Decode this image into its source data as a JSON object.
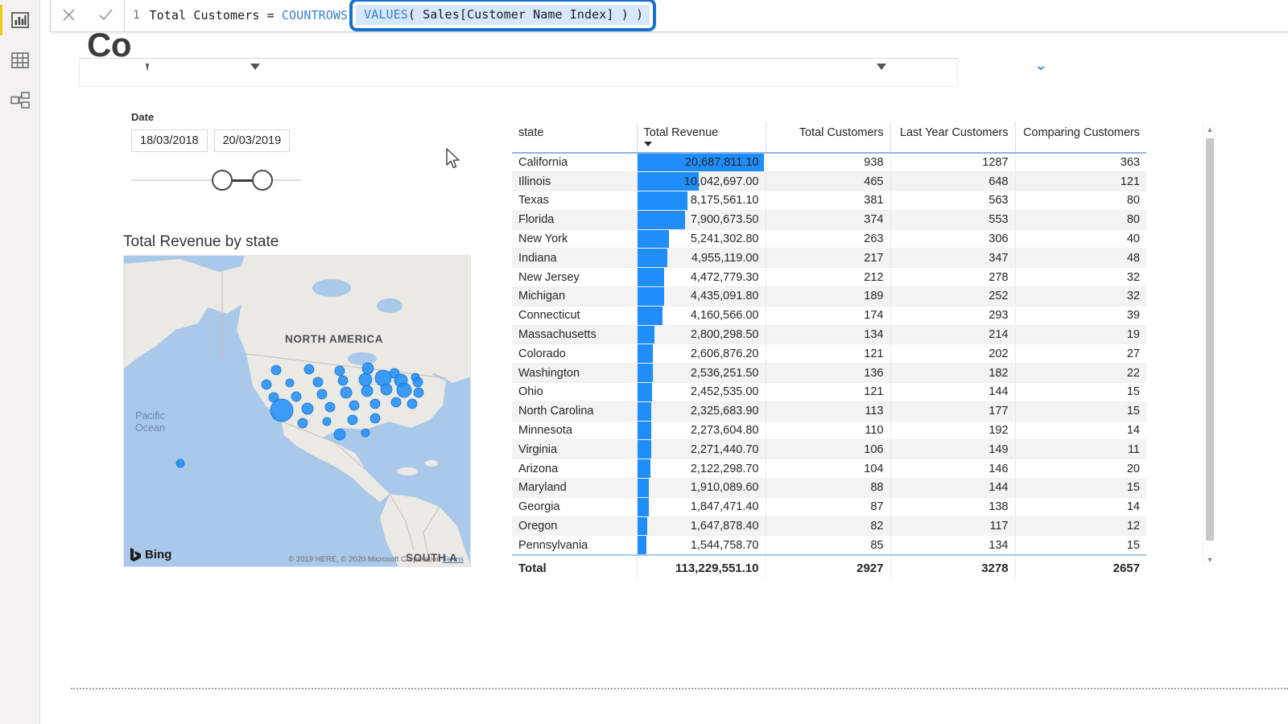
{
  "app": {
    "page_title": "Co",
    "rail_items": [
      {
        "name": "report-view",
        "icon": "bar-chart-icon",
        "active": true
      },
      {
        "name": "data-view",
        "icon": "table-icon",
        "active": false
      },
      {
        "name": "model-view",
        "icon": "relationships-icon",
        "active": false
      }
    ]
  },
  "formula_bar": {
    "cancel_label": "✕",
    "commit_label": "✓",
    "line_number": "1",
    "measure_name": "Total Customers",
    "equals": "=",
    "function_1": "COUNTROWS",
    "selected_expression": "VALUES( Sales[Customer Name Index] ) )",
    "selected_keyword": "VALUES",
    "selected_rest": "( Sales[Customer Name Index] ) )",
    "selection_outline_color": "#1870d2",
    "selection_bg_color": "#d6e8fb"
  },
  "slicer": {
    "label": "Date",
    "start_date": "18/03/2018",
    "end_date": "20/03/2019"
  },
  "map": {
    "title": "Total Revenue by state",
    "region_label_north": "NORTH AMERICA",
    "region_label_south": "SOUTH A",
    "ocean_label": "Pacific\nOcean",
    "ocean_label_line1": "Pacific",
    "ocean_label_line2": "Ocean",
    "brand": "Bing",
    "attribution": "© 2019 HERE, © 2020 Microsoft Corporation",
    "terms_link": "Terms",
    "bubble_color": "#1f8efa"
  },
  "table": {
    "columns": [
      "state",
      "Total Revenue",
      "Total Customers",
      "Last Year Customers",
      "Comparing Customers"
    ],
    "sort_column": "Total Revenue",
    "sort_direction": "descending",
    "data_bar_color": "#1f8efa",
    "rows": [
      {
        "state": "California",
        "total_revenue": "20,687,811.10",
        "revenue_value": 20687811.1,
        "total_customers": "938",
        "last_year_customers": "1287",
        "comparing_customers": "363"
      },
      {
        "state": "Illinois",
        "total_revenue": "10,042,697.00",
        "revenue_value": 10042697.0,
        "total_customers": "465",
        "last_year_customers": "648",
        "comparing_customers": "121"
      },
      {
        "state": "Texas",
        "total_revenue": "8,175,561.10",
        "revenue_value": 8175561.1,
        "total_customers": "381",
        "last_year_customers": "563",
        "comparing_customers": "80"
      },
      {
        "state": "Florida",
        "total_revenue": "7,900,673.50",
        "revenue_value": 7900673.5,
        "total_customers": "374",
        "last_year_customers": "553",
        "comparing_customers": "80"
      },
      {
        "state": "New York",
        "total_revenue": "5,241,302.80",
        "revenue_value": 5241302.8,
        "total_customers": "263",
        "last_year_customers": "306",
        "comparing_customers": "40"
      },
      {
        "state": "Indiana",
        "total_revenue": "4,955,119.00",
        "revenue_value": 4955119.0,
        "total_customers": "217",
        "last_year_customers": "347",
        "comparing_customers": "48"
      },
      {
        "state": "New Jersey",
        "total_revenue": "4,472,779.30",
        "revenue_value": 4472779.3,
        "total_customers": "212",
        "last_year_customers": "278",
        "comparing_customers": "32"
      },
      {
        "state": "Michigan",
        "total_revenue": "4,435,091.80",
        "revenue_value": 4435091.8,
        "total_customers": "189",
        "last_year_customers": "252",
        "comparing_customers": "32"
      },
      {
        "state": "Connecticut",
        "total_revenue": "4,160,566.00",
        "revenue_value": 4160566.0,
        "total_customers": "174",
        "last_year_customers": "293",
        "comparing_customers": "39"
      },
      {
        "state": "Massachusetts",
        "total_revenue": "2,800,298.50",
        "revenue_value": 2800298.5,
        "total_customers": "134",
        "last_year_customers": "214",
        "comparing_customers": "19"
      },
      {
        "state": "Colorado",
        "total_revenue": "2,606,876.20",
        "revenue_value": 2606876.2,
        "total_customers": "121",
        "last_year_customers": "202",
        "comparing_customers": "27"
      },
      {
        "state": "Washington",
        "total_revenue": "2,536,251.50",
        "revenue_value": 2536251.5,
        "total_customers": "136",
        "last_year_customers": "182",
        "comparing_customers": "22"
      },
      {
        "state": "Ohio",
        "total_revenue": "2,452,535.00",
        "revenue_value": 2452535.0,
        "total_customers": "121",
        "last_year_customers": "144",
        "comparing_customers": "15"
      },
      {
        "state": "North Carolina",
        "total_revenue": "2,325,683.90",
        "revenue_value": 2325683.9,
        "total_customers": "113",
        "last_year_customers": "177",
        "comparing_customers": "15"
      },
      {
        "state": "Minnesota",
        "total_revenue": "2,273,604.80",
        "revenue_value": 2273604.8,
        "total_customers": "110",
        "last_year_customers": "192",
        "comparing_customers": "14"
      },
      {
        "state": "Virginia",
        "total_revenue": "2,271,440.70",
        "revenue_value": 2271440.7,
        "total_customers": "106",
        "last_year_customers": "149",
        "comparing_customers": "11"
      },
      {
        "state": "Arizona",
        "total_revenue": "2,122,298.70",
        "revenue_value": 2122298.7,
        "total_customers": "104",
        "last_year_customers": "146",
        "comparing_customers": "20"
      },
      {
        "state": "Maryland",
        "total_revenue": "1,910,089.60",
        "revenue_value": 1910089.6,
        "total_customers": "88",
        "last_year_customers": "144",
        "comparing_customers": "15"
      },
      {
        "state": "Georgia",
        "total_revenue": "1,847,471.40",
        "revenue_value": 1847471.4,
        "total_customers": "87",
        "last_year_customers": "138",
        "comparing_customers": "14"
      },
      {
        "state": "Oregon",
        "total_revenue": "1,647,878.40",
        "revenue_value": 1647878.4,
        "total_customers": "82",
        "last_year_customers": "117",
        "comparing_customers": "12"
      },
      {
        "state": "Pennsylvania",
        "total_revenue": "1,544,758.70",
        "revenue_value": 1544758.7,
        "total_customers": "85",
        "last_year_customers": "134",
        "comparing_customers": "15"
      }
    ],
    "total_row": {
      "state": "Total",
      "total_revenue": "113,229,551.10",
      "total_customers": "2927",
      "last_year_customers": "3278",
      "comparing_customers": "2657"
    }
  },
  "chart_data": {
    "type": "bar",
    "title": "Total Revenue by state",
    "xlabel": "",
    "ylabel": "Total Revenue",
    "categories": [
      "California",
      "Illinois",
      "Texas",
      "Florida",
      "New York",
      "Indiana",
      "New Jersey",
      "Michigan",
      "Connecticut",
      "Massachusetts",
      "Colorado",
      "Washington",
      "Ohio",
      "North Carolina",
      "Minnesota",
      "Virginia",
      "Arizona",
      "Maryland",
      "Georgia",
      "Oregon",
      "Pennsylvania"
    ],
    "series": [
      {
        "name": "Total Revenue",
        "values": [
          20687811.1,
          10042697.0,
          8175561.1,
          7900673.5,
          5241302.8,
          4955119.0,
          4472779.3,
          4435091.8,
          4160566.0,
          2800298.5,
          2606876.2,
          2536251.5,
          2452535.0,
          2325683.9,
          2273604.8,
          2271440.7,
          2122298.7,
          1910089.6,
          1847471.4,
          1647878.4,
          1544758.7
        ]
      },
      {
        "name": "Total Customers",
        "values": [
          938,
          465,
          381,
          374,
          263,
          217,
          212,
          189,
          174,
          134,
          121,
          136,
          121,
          113,
          110,
          106,
          104,
          88,
          87,
          82,
          85
        ]
      },
      {
        "name": "Last Year Customers",
        "values": [
          1287,
          648,
          563,
          553,
          306,
          347,
          278,
          252,
          293,
          214,
          202,
          182,
          144,
          177,
          192,
          149,
          146,
          144,
          138,
          117,
          134
        ]
      },
      {
        "name": "Comparing Customers",
        "values": [
          363,
          121,
          80,
          80,
          40,
          48,
          32,
          32,
          39,
          19,
          27,
          22,
          15,
          15,
          14,
          11,
          20,
          15,
          14,
          12,
          15
        ]
      }
    ],
    "totals": {
      "Total Revenue": 113229551.1,
      "Total Customers": 2927,
      "Last Year Customers": 3278,
      "Comparing Customers": 2657
    },
    "grid": false,
    "legend": "none"
  }
}
